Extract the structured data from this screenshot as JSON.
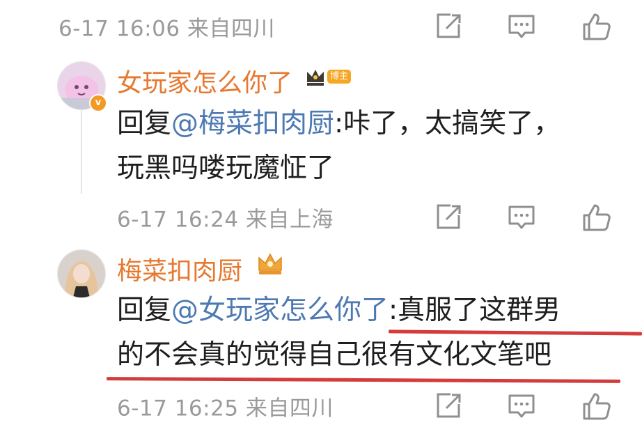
{
  "comments": [
    {
      "time": "6-17 16:06",
      "location": "来自四川"
    },
    {
      "username": "女玩家怎么你了",
      "badge": "博主",
      "reply_prefix": "回复",
      "mention": "@梅菜扣肉厨",
      "reply_line1": ":咔了，太搞笑了，",
      "reply_line2": "玩黑吗喽玩魔怔了",
      "time": "6-17 16:24",
      "location": "来自上海",
      "verified_mark": "v"
    },
    {
      "username": "梅菜扣肉厨",
      "reply_prefix": "回复",
      "mention": "@女玩家怎么你了",
      "reply_line1": ":真服了这群男",
      "reply_line2": "的不会真的觉得自己很有文化文笔吧",
      "time": "6-17 16:25",
      "location": "来自四川"
    }
  ],
  "icons": [
    "share-icon",
    "comment-icon",
    "like-icon"
  ],
  "colors": {
    "username": "#e6782f",
    "mention": "#4d79b3",
    "meta_text": "#9a9a9a",
    "icon": "#8f8f8f",
    "underline": "#d43b3b",
    "badge": "#f5a623"
  }
}
